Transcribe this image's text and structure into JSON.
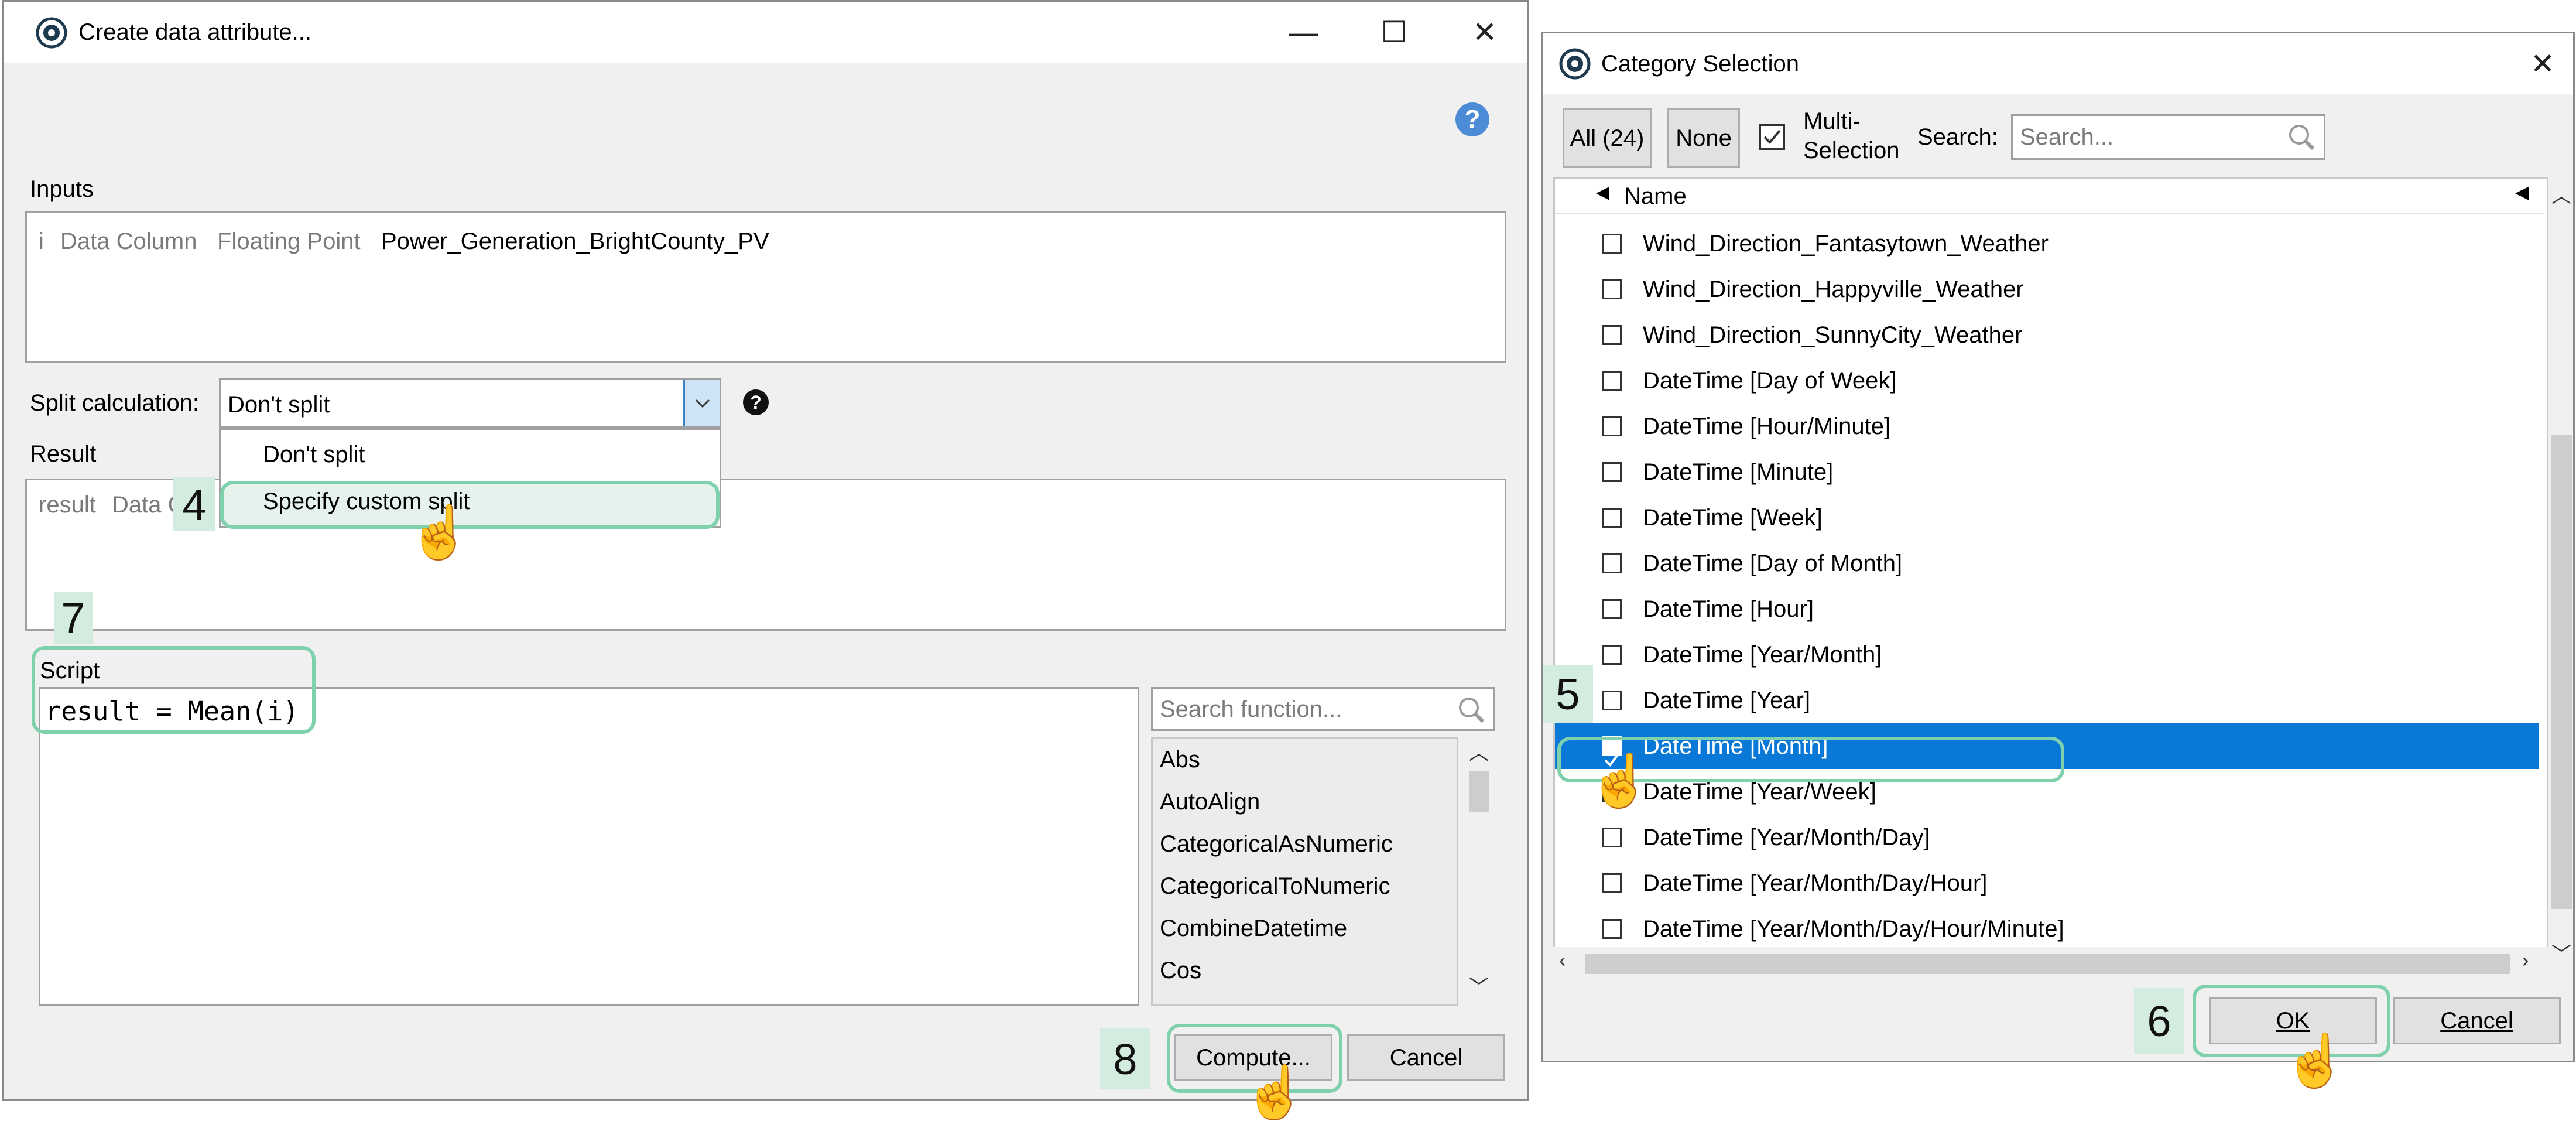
{
  "create_dialog": {
    "title": "Create data attribute...",
    "window_controls": {
      "minimize": "—",
      "maximize": "☐",
      "close": "✕"
    },
    "help_glyph": "?",
    "inputs": {
      "label": "Inputs",
      "row": {
        "name": "i",
        "type": "Data Column",
        "subtype": "Floating Point",
        "value": "Power_Generation_BrightCounty_PV"
      }
    },
    "split": {
      "label": "Split calculation:",
      "selected": "Don't split",
      "options": [
        "Don't split",
        "Specify custom split"
      ],
      "info_glyph": "?"
    },
    "result": {
      "label": "Result",
      "name": "result",
      "type_partial": "Data C"
    },
    "script": {
      "label": "Script",
      "code": "result = Mean(i)"
    },
    "function_search": {
      "placeholder": "Search function..."
    },
    "functions": [
      "Abs",
      "AutoAlign",
      "CategoricalAsNumeric",
      "CategoricalToNumeric",
      "CombineDatetime",
      "Cos"
    ],
    "buttons": {
      "compute": "Compute...",
      "cancel": "Cancel"
    }
  },
  "category_dialog": {
    "title": "Category Selection",
    "close_glyph": "✕",
    "toolbar": {
      "all": "All (24)",
      "none": "None",
      "multi_line1": "Multi-",
      "multi_line2": "Selection",
      "multi_checked": true,
      "search_label": "Search:",
      "search_placeholder": "Search..."
    },
    "column_header": "Name",
    "rows": [
      {
        "label": "Wind_Direction_Fantasytown_Weather",
        "checked": false
      },
      {
        "label": "Wind_Direction_Happyville_Weather",
        "checked": false
      },
      {
        "label": "Wind_Direction_SunnyCity_Weather",
        "checked": false
      },
      {
        "label": "DateTime [Day of Week]",
        "checked": false
      },
      {
        "label": "DateTime [Hour/Minute]",
        "checked": false
      },
      {
        "label": "DateTime [Minute]",
        "checked": false
      },
      {
        "label": "DateTime [Week]",
        "checked": false
      },
      {
        "label": "DateTime [Day of Month]",
        "checked": false
      },
      {
        "label": "DateTime [Hour]",
        "checked": false
      },
      {
        "label": "DateTime [Year/Month]",
        "checked": false
      },
      {
        "label": "DateTime [Year]",
        "checked": false
      },
      {
        "label": "DateTime [Month]",
        "checked": true,
        "selected": true
      },
      {
        "label": "DateTime [Year/Week]",
        "checked": false
      },
      {
        "label": "DateTime [Year/Month/Day]",
        "checked": false
      },
      {
        "label": "DateTime [Year/Month/Day/Hour]",
        "checked": false
      },
      {
        "label": "DateTime [Year/Month/Day/Hour/Minute]",
        "checked": false
      }
    ],
    "buttons": {
      "ok": "OK",
      "cancel": "Cancel"
    }
  },
  "steps": [
    "4",
    "5",
    "6",
    "7",
    "8"
  ],
  "colors": {
    "accent_highlight": "#7fd1ad",
    "step_badge_bg": "#d3ecdf",
    "selection_blue": "#0a78d7",
    "dialog_bg": "#f0f0f0"
  },
  "icons": [
    "app-logo-icon",
    "help-icon",
    "search-icon",
    "dropdown-chevron-icon",
    "hand-cursor-icon",
    "checkbox-icon"
  ]
}
